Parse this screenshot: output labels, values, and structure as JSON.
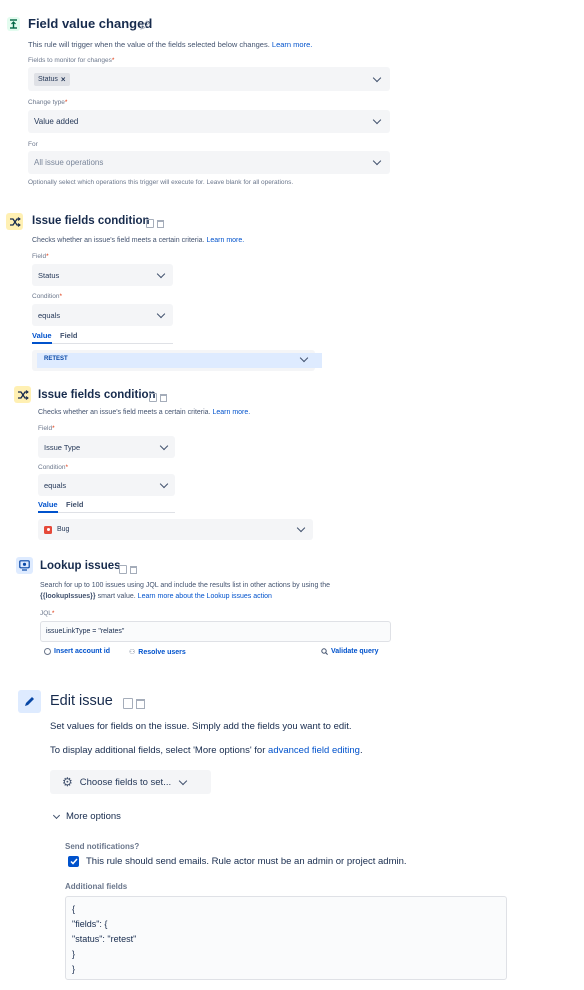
{
  "trigger": {
    "title": "Field value changed",
    "description": "This rule will trigger when the value of the fields selected below changes.",
    "learn_more": "Learn more.",
    "fields_label": "Fields to monitor for changes",
    "fields_chip": "Status",
    "change_type_label": "Change type",
    "change_type_value": "Value added",
    "for_label": "For",
    "for_placeholder": "All issue operations",
    "for_hint": "Optionally select which operations this trigger will execute for. Leave blank for all operations."
  },
  "condition1": {
    "title": "Issue fields condition",
    "description": "Checks whether an issue's field meets a certain criteria.",
    "learn_more": "Learn more.",
    "field_label": "Field",
    "field_value": "Status",
    "condition_label": "Condition",
    "condition_value": "equals",
    "tab_value": "Value",
    "tab_field": "Field",
    "selected_value": "RETEST"
  },
  "condition2": {
    "title": "Issue fields condition",
    "description": "Checks whether an issue's field meets a certain criteria.",
    "learn_more": "Learn more.",
    "field_label": "Field",
    "field_value": "Issue Type",
    "condition_label": "Condition",
    "condition_value": "equals",
    "tab_value": "Value",
    "tab_field": "Field",
    "selected_value": "Bug"
  },
  "lookup": {
    "title": "Lookup issues",
    "description_line1": "Search for up to 100 issues using JQL and include the results list in other actions by using the",
    "smart_value": "{{lookupIssues}}",
    "description_line2": "smart value.",
    "learn_more": "Learn more about the Lookup issues action",
    "jql_label": "JQL",
    "jql_value": "issueLinkType = \"relates\"",
    "insert_account": "Insert account id",
    "resolve_users": "Resolve users",
    "validate": "Validate query"
  },
  "edit": {
    "title": "Edit issue",
    "description1": "Set values for fields on the issue. Simply add the fields you want to edit.",
    "description2_prefix": "To display additional fields, select 'More options' for",
    "description2_link": "advanced field editing",
    "description2_suffix": ".",
    "choose_fields": "Choose fields to set...",
    "more_options": "More options",
    "send_notifications_label": "Send notifications?",
    "send_notifications_text": "This rule should send emails. Rule actor must be an admin or project admin.",
    "additional_fields_label": "Additional fields",
    "json_lines": [
      "{",
      "\"fields\": {",
      "\"status\": \"retest\"",
      "}",
      "}"
    ]
  },
  "colors": {
    "trigger_icon_bg": "#e3fcef",
    "condition_icon_bg": "#fff0b3",
    "action_icon_bg": "#deebff",
    "link": "#0052cc"
  }
}
